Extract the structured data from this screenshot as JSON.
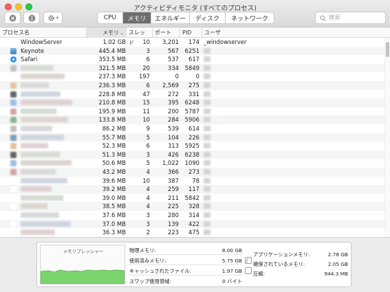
{
  "window": {
    "title": "アクティビティモニタ (すべてのプロセス)"
  },
  "toolbar": {
    "gear_menu": "▾"
  },
  "tabs": [
    {
      "label": "CPU",
      "active": false
    },
    {
      "label": "メモリ",
      "active": true
    },
    {
      "label": "エネルギー",
      "active": false
    },
    {
      "label": "ディスク",
      "active": false
    },
    {
      "label": "ネットワーク",
      "active": false
    }
  ],
  "search": {
    "placeholder": "検索",
    "value": ""
  },
  "table": {
    "headers": {
      "name": "プロセス名",
      "memory": "メモリ",
      "threads": "スレッド",
      "ports": "ポート",
      "pid": "PID",
      "user": "ユーザ"
    },
    "rows": [
      {
        "name": "WindowServer",
        "memory": "1.02 GB",
        "threads": "10",
        "ports": "3,201",
        "pid": "174",
        "user": "_windowserver",
        "icon": "window-icon"
      },
      {
        "name": "Keynote",
        "memory": "445.4 MB",
        "threads": "3",
        "ports": "567",
        "pid": "6251",
        "user": "",
        "icon": "keynote-icon"
      },
      {
        "name": "Safari",
        "memory": "353.5 MB",
        "threads": "6",
        "ports": "537",
        "pid": "617",
        "user": "",
        "icon": "safari-icon"
      },
      {
        "name": "",
        "memory": "321.5 MB",
        "threads": "20",
        "ports": "334",
        "pid": "5849",
        "user": "",
        "icon": "app-icon"
      },
      {
        "name": "",
        "memory": "237.3 MB",
        "threads": "197",
        "ports": "0",
        "pid": "0",
        "user": "",
        "icon": "blank-icon"
      },
      {
        "name": "",
        "memory": "236.3 MB",
        "threads": "6",
        "ports": "2,569",
        "pid": "275",
        "user": "",
        "icon": "app-icon"
      },
      {
        "name": "",
        "memory": "228.8 MB",
        "threads": "47",
        "ports": "272",
        "pid": "331",
        "user": "",
        "icon": "app-icon"
      },
      {
        "name": "",
        "memory": "210.8 MB",
        "threads": "15",
        "ports": "395",
        "pid": "6248",
        "user": "",
        "icon": "app-icon"
      },
      {
        "name": "",
        "memory": "195.9 MB",
        "threads": "11",
        "ports": "200",
        "pid": "5787",
        "user": "",
        "icon": "app-icon"
      },
      {
        "name": "",
        "memory": "133.8 MB",
        "threads": "10",
        "ports": "284",
        "pid": "5906",
        "user": "",
        "icon": "app-icon"
      },
      {
        "name": "",
        "memory": "86.2 MB",
        "threads": "9",
        "ports": "539",
        "pid": "614",
        "user": "",
        "icon": "app-icon"
      },
      {
        "name": "",
        "memory": "55.7 MB",
        "threads": "5",
        "ports": "104",
        "pid": "226",
        "user": "",
        "icon": "app-icon"
      },
      {
        "name": "",
        "memory": "52.3 MB",
        "threads": "6",
        "ports": "313",
        "pid": "5925",
        "user": "",
        "icon": "app-icon"
      },
      {
        "name": "",
        "memory": "51.3 MB",
        "threads": "3",
        "ports": "426",
        "pid": "6238",
        "user": "",
        "icon": "app-icon"
      },
      {
        "name": "",
        "memory": "50.6 MB",
        "threads": "5",
        "ports": "1,022",
        "pid": "1090",
        "user": "",
        "icon": "app-icon"
      },
      {
        "name": "",
        "memory": "43.2 MB",
        "threads": "4",
        "ports": "366",
        "pid": "273",
        "user": "",
        "icon": "app-icon"
      },
      {
        "name": "",
        "memory": "39.6 MB",
        "threads": "10",
        "ports": "387",
        "pid": "78",
        "user": "",
        "icon": "blank-icon"
      },
      {
        "name": "",
        "memory": "39.2 MB",
        "threads": "4",
        "ports": "259",
        "pid": "117",
        "user": "",
        "icon": "blank-icon"
      },
      {
        "name": "",
        "memory": "39.0 MB",
        "threads": "4",
        "ports": "211",
        "pid": "5842",
        "user": "",
        "icon": "blank-icon"
      },
      {
        "name": "",
        "memory": "38.5 MB",
        "threads": "4",
        "ports": "225",
        "pid": "328",
        "user": "",
        "icon": "blank-icon"
      },
      {
        "name": "",
        "memory": "37.6 MB",
        "threads": "3",
        "ports": "280",
        "pid": "314",
        "user": "",
        "icon": "blank-icon"
      },
      {
        "name": "",
        "memory": "37.0 MB",
        "threads": "3",
        "ports": "139",
        "pid": "422",
        "user": "",
        "icon": "blank-icon"
      },
      {
        "name": "",
        "memory": "36.3 MB",
        "threads": "2",
        "ports": "223",
        "pid": "475",
        "user": "",
        "icon": "blank-icon"
      }
    ]
  },
  "memory_summary": {
    "pressure_title": "メモリプレッシャー",
    "physical_label": "物理メモリ:",
    "physical_value": "8.00 GB",
    "used_label": "使用済みメモリ:",
    "used_value": "5.75 GB",
    "cached_label": "キャッシュされたファイル:",
    "cached_value": "1.97 GB",
    "swap_label": "スワップ使用領域:",
    "swap_value": "0 バイト",
    "app_label": "アプリケーションメモリ:",
    "app_value": "2.78 GB",
    "wired_label": "確保されているメモリ:",
    "wired_value": "2.05 GB",
    "compressed_label": "圧縮:",
    "compressed_value": "944.3 MB"
  },
  "colors": {
    "pressure_fill": "#7bd46d",
    "pressure_stroke": "#4fae43",
    "active_tab": "#6d6d6d"
  }
}
